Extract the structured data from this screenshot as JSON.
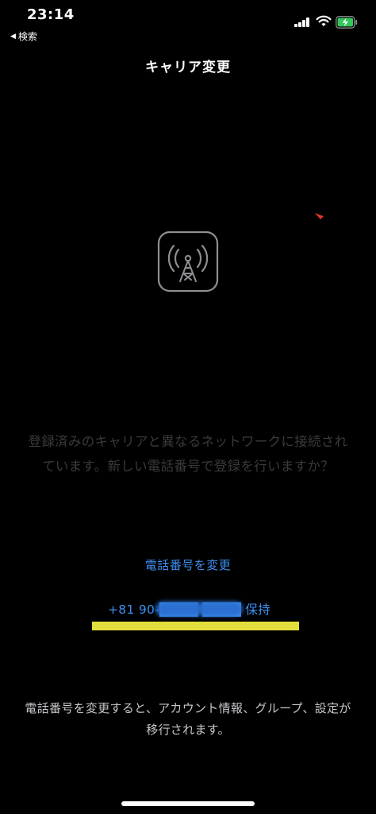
{
  "status_bar": {
    "time": "23:14",
    "back_label": "検索",
    "back_glyph": "◀"
  },
  "nav": {
    "title": "キャリア変更"
  },
  "icons": {
    "carrier": "antenna-tower-icon",
    "red_mark": "red-mark-icon"
  },
  "content": {
    "message_line1": "登録済みのキャリアと異なるネットワークに接続され",
    "message_line2": "ています。新しい電話番号で登録を行いますか？",
    "change_number_label": "電話番号を変更",
    "keep_number_label": "+81 90-████ ████ 保持",
    "footer_line1": "電話番号を変更すると、アカウント情報、グループ、設定が",
    "footer_line2": "移行されます。"
  },
  "colors": {
    "link": "#3e8ef0",
    "message": "#3a3a3c",
    "highlight": "#e2df3c",
    "battery_charge": "#34c759"
  }
}
